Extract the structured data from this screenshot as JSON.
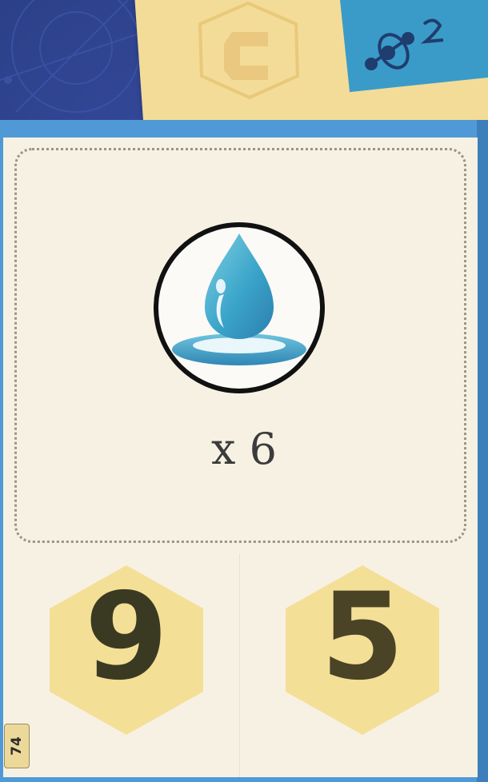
{
  "card": {
    "resource_icon": "water-drop-icon",
    "multiplier_text": "x 6",
    "left_value": "9",
    "right_value": "5",
    "card_number": "74"
  },
  "background": {
    "back_card_icon": "letter-c-hex-icon",
    "teal_card_icon": "molecule-icon"
  },
  "colors": {
    "table_blue": "#2b3f86",
    "card_border_blue": "#4f9ad6",
    "card_face": "#f7f1e4",
    "hex_yellow": "#f4df97",
    "digit_dark": "#3a3a22",
    "water_blue": "#3aa4c9",
    "back_card_yellow": "#f3dc98",
    "teal_card": "#3a9bc8"
  }
}
